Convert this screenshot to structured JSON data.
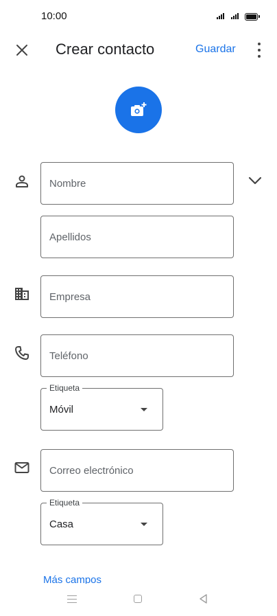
{
  "status_bar": {
    "time": "10:00"
  },
  "top_bar": {
    "title": "Crear contacto",
    "save_label": "Guardar"
  },
  "fields": {
    "first_name_placeholder": "Nombre",
    "last_name_placeholder": "Apellidos",
    "company_placeholder": "Empresa",
    "phone_placeholder": "Teléfono",
    "phone_label_legend": "Etiqueta",
    "phone_label_value": "Móvil",
    "email_placeholder": "Correo electrónico",
    "email_label_legend": "Etiqueta",
    "email_label_value": "Casa"
  },
  "more_fields_label": "Más campos",
  "icons": {
    "close": "close-icon",
    "more": "more-vert-icon",
    "photo": "add-photo-icon",
    "person": "person-icon",
    "expand": "chevron-down-icon",
    "company": "business-icon",
    "phone": "phone-icon",
    "email": "email-icon"
  },
  "colors": {
    "accent": "#1a73e8",
    "text": "#202124",
    "outline": "#6f6f6f"
  }
}
